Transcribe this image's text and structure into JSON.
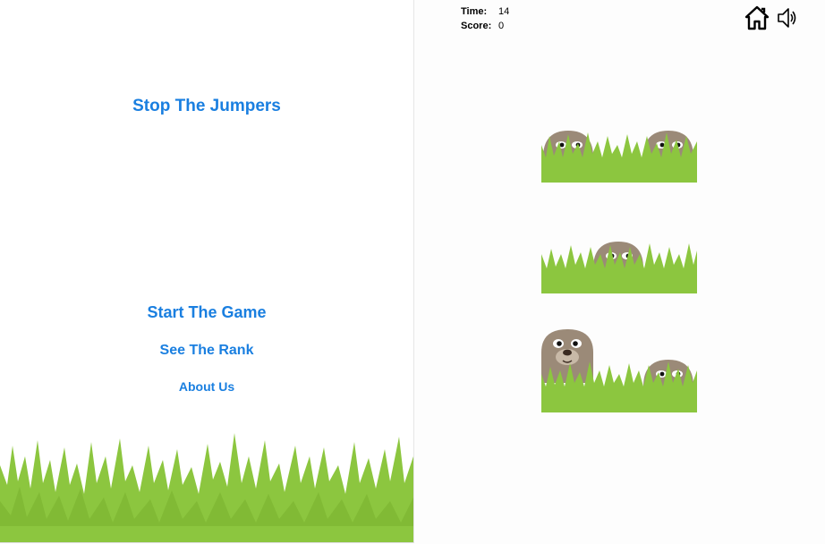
{
  "game": {
    "title": "Stop The Jumpers",
    "menu": {
      "start_label": "Start The Game",
      "rank_label": "See The Rank",
      "about_label": "About Us"
    },
    "hud": {
      "time_label": "Time:",
      "time_value": "14",
      "score_label": "Score:",
      "score_value": "0"
    },
    "icons": {
      "home": "home-icon",
      "sound": "speaker-icon"
    },
    "colors": {
      "link": "#1a7fe0",
      "grass": "#8cc63f",
      "grass_dark": "#78b02e",
      "mole": "#9b8a78"
    },
    "holes": [
      {
        "id": 1,
        "moles": [
          "peeking",
          "peeking"
        ]
      },
      {
        "id": 2,
        "moles": [
          "peeking"
        ]
      },
      {
        "id": 3,
        "moles": [
          "jumped-out",
          "peeking"
        ]
      }
    ]
  }
}
